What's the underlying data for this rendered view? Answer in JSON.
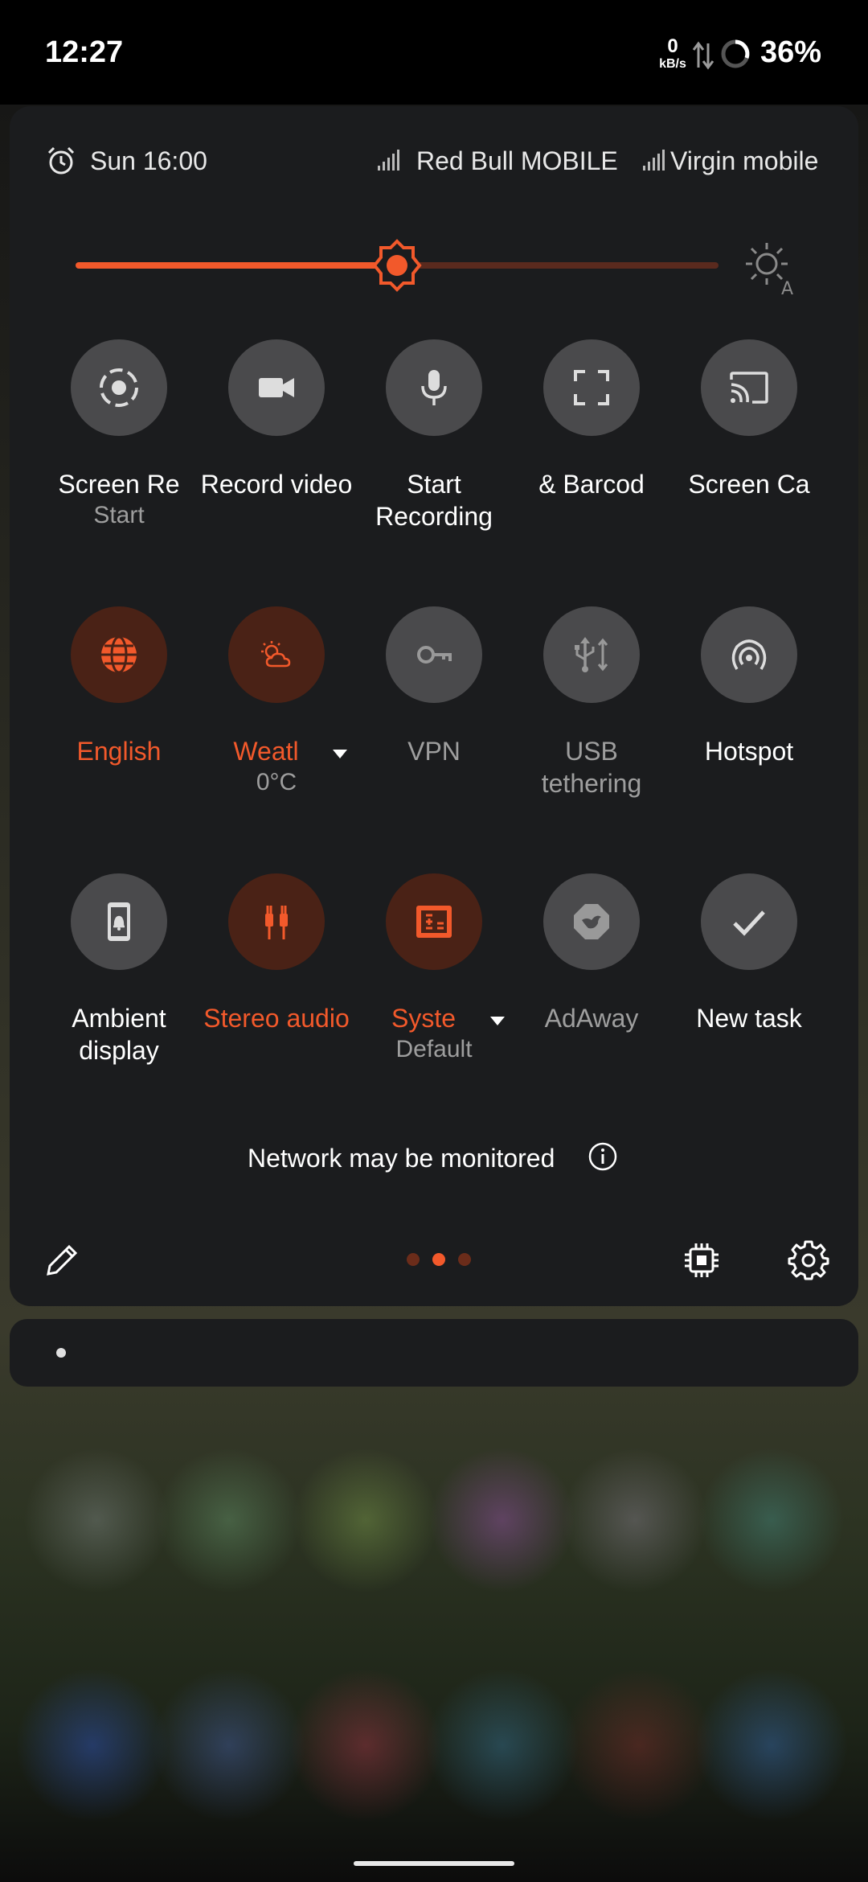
{
  "status_bar": {
    "time": "12:27",
    "net_speed_value": "0",
    "net_speed_unit": "kB/s",
    "battery": "36%"
  },
  "panel": {
    "alarm": "Sun 16:00",
    "carriers": [
      "Red Bull MOBILE",
      "Virgin mobile"
    ],
    "brightness_level": 0.52,
    "accent_color": "#f2592b",
    "tiles": [
      {
        "label": "Screen Re",
        "sub": "Start",
        "icon": "screen-record-icon",
        "active": false
      },
      {
        "label": "Record video",
        "sub": "",
        "icon": "video-camera-icon",
        "active": false
      },
      {
        "label": "Start Recording",
        "sub": "",
        "icon": "microphone-icon",
        "active": false
      },
      {
        "label": "& Barcod",
        "sub": "",
        "icon": "scan-frame-icon",
        "active": false
      },
      {
        "label": "Screen Ca",
        "sub": "",
        "icon": "cast-icon",
        "active": false
      },
      {
        "label": "English",
        "sub": "",
        "icon": "globe-icon",
        "active": true
      },
      {
        "label": "Weatl",
        "sub": "0°C",
        "icon": "weather-icon",
        "active": true
      },
      {
        "label": "VPN",
        "sub": "",
        "icon": "vpn-key-icon",
        "active": false
      },
      {
        "label": "USB tethering",
        "sub": "",
        "icon": "usb-icon",
        "active": false
      },
      {
        "label": "Hotspot",
        "sub": "",
        "icon": "hotspot-icon",
        "active": false
      },
      {
        "label": "Ambient display",
        "sub": "",
        "icon": "ambient-display-icon",
        "active": false
      },
      {
        "label": "Stereo audio",
        "sub": "",
        "icon": "stereo-audio-icon",
        "active": true
      },
      {
        "label": "Syste",
        "sub": "Default",
        "icon": "system-calculator-icon",
        "active": true
      },
      {
        "label": "AdAway",
        "sub": "",
        "icon": "adaway-icon",
        "active": false
      },
      {
        "label": "New task",
        "sub": "",
        "icon": "checkmark-icon",
        "active": false
      }
    ],
    "network_notice": "Network may be monitored",
    "page_indicator": {
      "pages": 3,
      "current": 2
    }
  }
}
